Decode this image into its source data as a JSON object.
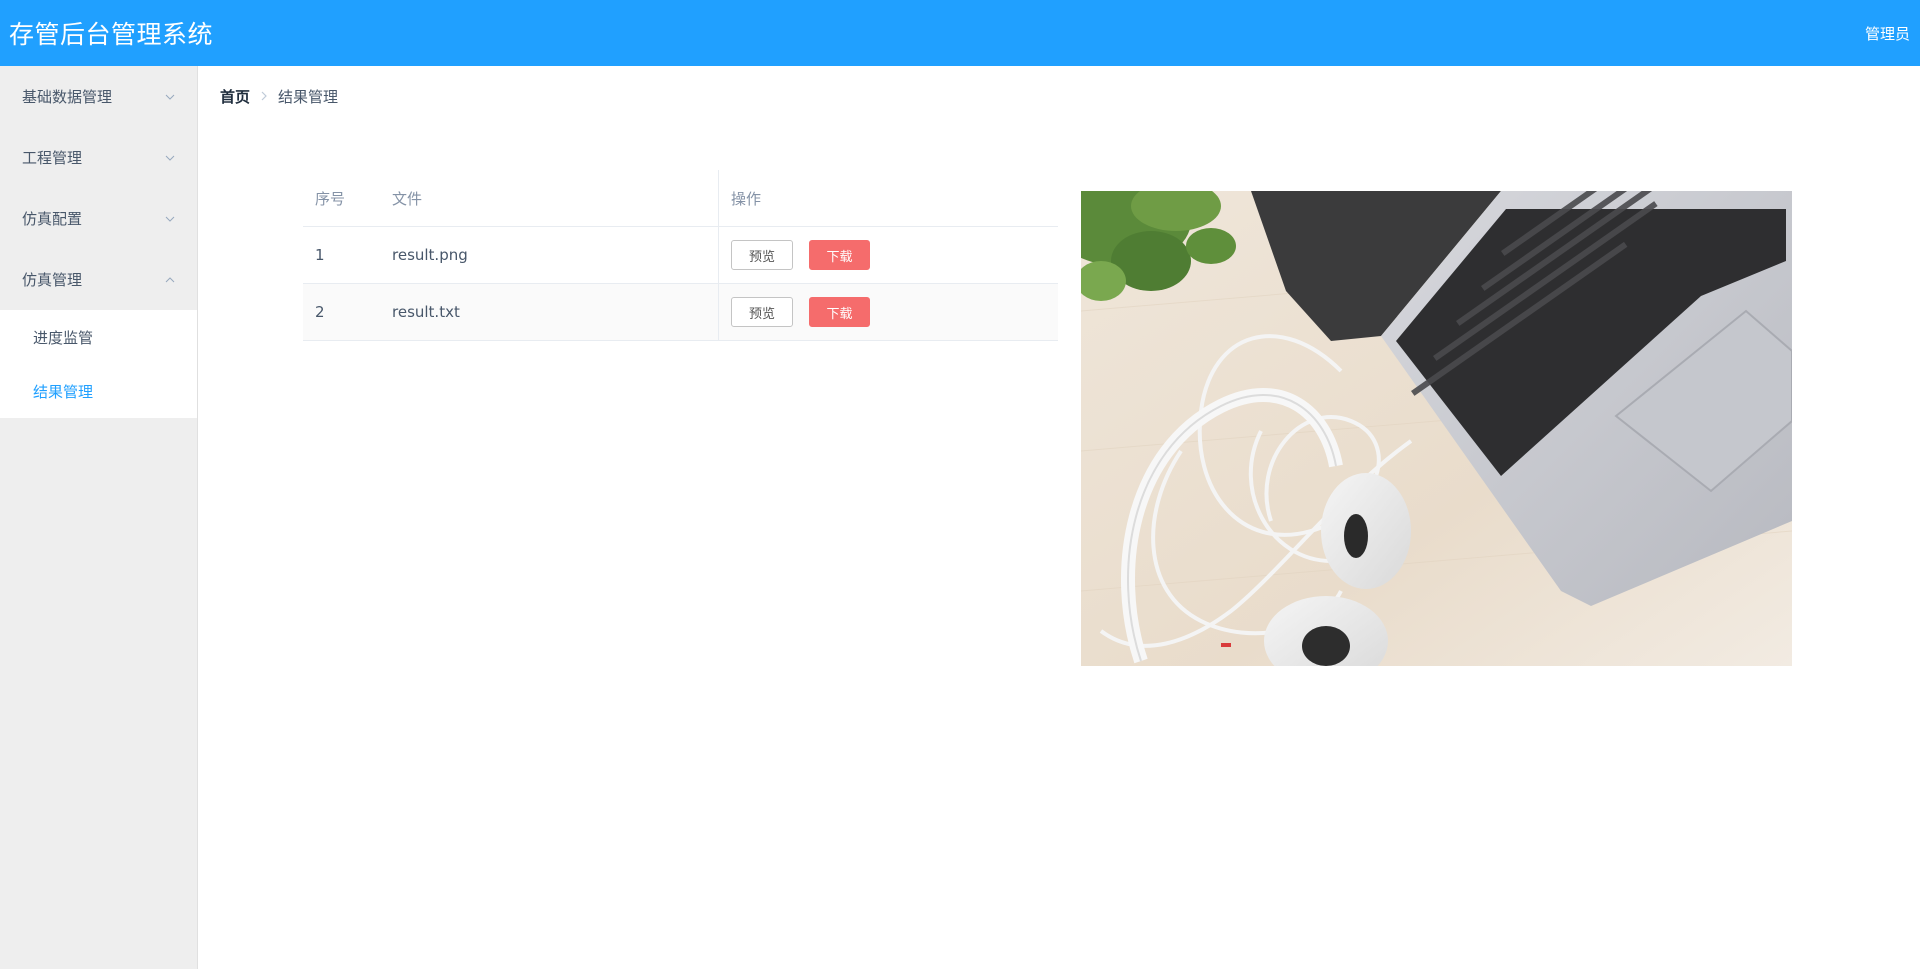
{
  "header": {
    "title": "存管后台管理系统",
    "user": "管理员"
  },
  "sidebar": {
    "items": [
      {
        "label": "基础数据管理",
        "expanded": false
      },
      {
        "label": "工程管理",
        "expanded": false
      },
      {
        "label": "仿真配置",
        "expanded": false
      },
      {
        "label": "仿真管理",
        "expanded": true
      }
    ],
    "subitems": [
      {
        "label": "进度监管",
        "active": false
      },
      {
        "label": "结果管理",
        "active": true
      }
    ]
  },
  "breadcrumb": {
    "home": "首页",
    "current": "结果管理"
  },
  "table": {
    "headers": {
      "index": "序号",
      "file": "文件",
      "ops": "操作"
    },
    "rows": [
      {
        "index": "1",
        "file": "result.png",
        "preview": "预览",
        "download": "下载"
      },
      {
        "index": "2",
        "file": "result.txt",
        "preview": "预览",
        "download": "下载"
      }
    ]
  },
  "colors": {
    "primary": "#20a0ff",
    "danger": "#f56c6c",
    "sidebar_bg": "#eeeeee"
  }
}
